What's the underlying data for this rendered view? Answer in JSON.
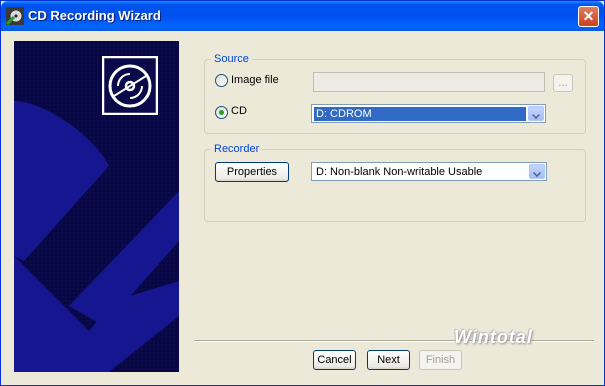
{
  "window": {
    "title": "CD Recording Wizard",
    "close_label": "✕"
  },
  "source": {
    "legend": "Source",
    "image_file_label": "Image file",
    "image_file_value": "",
    "browse_label": "...",
    "cd_label": "CD",
    "selected_option": "CD",
    "cd_drive": "D: CDROM"
  },
  "recorder": {
    "legend": "Recorder",
    "properties_label": "Properties",
    "device": "D: Non-blank Non-writable Usable"
  },
  "buttons": {
    "cancel": "Cancel",
    "next": "Next",
    "finish": "Finish"
  },
  "watermark": "Wintotal",
  "colors": {
    "title_bar": "#0053ee",
    "panel": "#0a0a4a",
    "anchor": "#161690",
    "accent": "#0046d5"
  }
}
